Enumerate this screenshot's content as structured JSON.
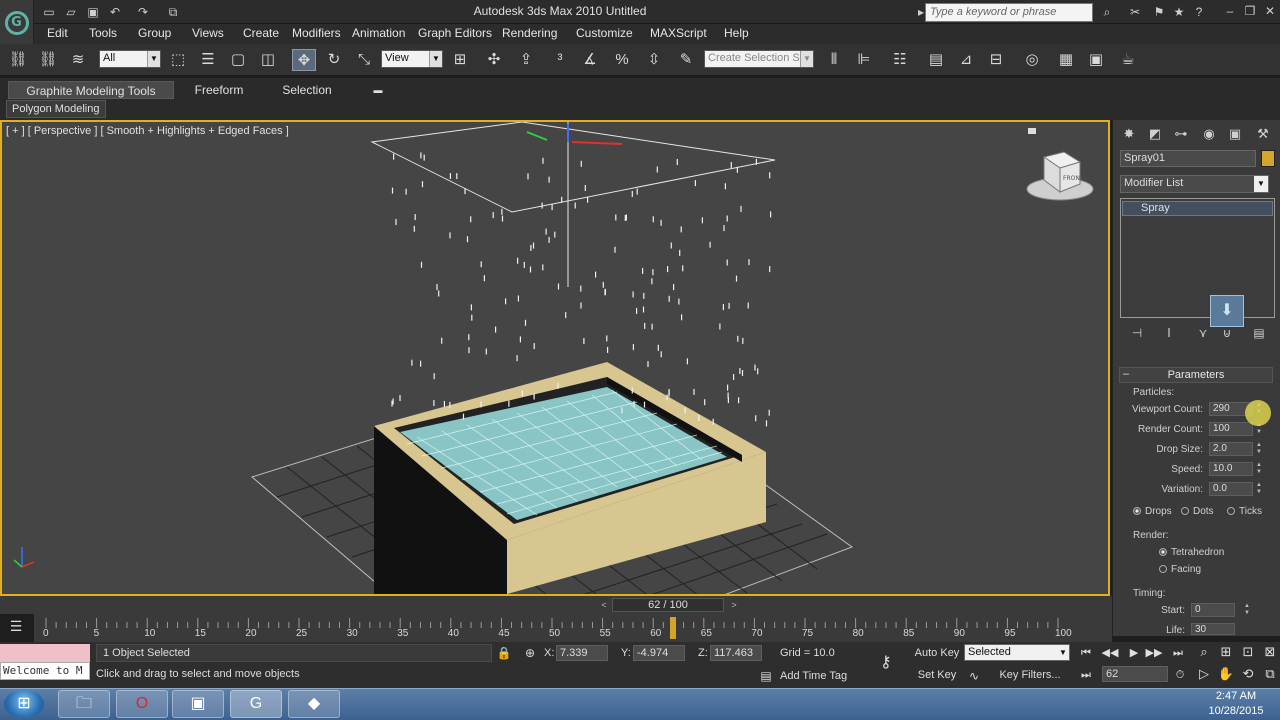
{
  "window": {
    "title": "Autodesk 3ds Max  2010       Untitled",
    "search_placeholder": "Type a keyword or phrase"
  },
  "menu": [
    "Edit",
    "Tools",
    "Group",
    "Views",
    "Create",
    "Modifiers",
    "Animation",
    "Graph Editors",
    "Rendering",
    "Customize",
    "MAXScript",
    "Help"
  ],
  "toolbar": {
    "selection_filter": "All",
    "reference_coord": "View",
    "named_selection_placeholder": "Create Selection Se"
  },
  "ribbon": {
    "tabs": [
      "Graphite Modeling Tools",
      "Freeform",
      "Selection"
    ],
    "active_tab": "Graphite Modeling Tools",
    "subtab": "Polygon Modeling"
  },
  "viewport": {
    "label": "[ + ] [ Perspective ] [ Smooth + Highlights + Edged Faces ]",
    "viewcube_label": "FRONT",
    "accent_color": "#e1b01a"
  },
  "command_panel": {
    "object_name": "Spray01",
    "object_color": "#d4a52a",
    "modifier_list": "Modifier List",
    "stack_item": "Spray",
    "rollout_title": "Parameters",
    "particles_group": "Particles:",
    "fields": [
      {
        "label": "Viewport Count:",
        "value": "290"
      },
      {
        "label": "Render Count:",
        "value": "100"
      },
      {
        "label": "Drop Size:",
        "value": "2.0"
      },
      {
        "label": "Speed:",
        "value": "10.0"
      },
      {
        "label": "Variation:",
        "value": "0.0"
      }
    ],
    "display_options": [
      "Drops",
      "Dots",
      "Ticks"
    ],
    "selected_display": "Drops",
    "render_group": "Render:",
    "render_options": [
      "Tetrahedron",
      "Facing"
    ],
    "selected_render": "Tetrahedron",
    "timing_group": "Timing:",
    "timing_fields": [
      {
        "label": "Start:",
        "value": "0"
      },
      {
        "label": "Life:",
        "value": "30"
      }
    ]
  },
  "timeline": {
    "current_frame": 62,
    "total_frames": 100,
    "frame_readout": "62 / 100",
    "ticks": [
      "0",
      "5",
      "10",
      "15",
      "20",
      "25",
      "30",
      "35",
      "40",
      "45",
      "50",
      "55",
      "60",
      "65",
      "70",
      "75",
      "80",
      "85",
      "90",
      "95",
      "100"
    ]
  },
  "status": {
    "maxscript_text": "Welcome to M",
    "selection": "1 Object Selected",
    "prompt": "Click and drag to select and move objects",
    "x_label": "X:",
    "x_value": "7.339",
    "y_label": "Y:",
    "y_value": "-4.974",
    "z_label": "Z:",
    "z_value": "117.463",
    "grid": "Grid = 10.0",
    "add_time_tag": "Add Time Tag",
    "auto_key": "Auto Key",
    "set_key": "Set Key",
    "key_mode": "Selected",
    "key_filters": "Key Filters...",
    "frame_value": "62"
  },
  "taskbar": {
    "time": "2:47 AM",
    "date": "10/28/2015"
  }
}
